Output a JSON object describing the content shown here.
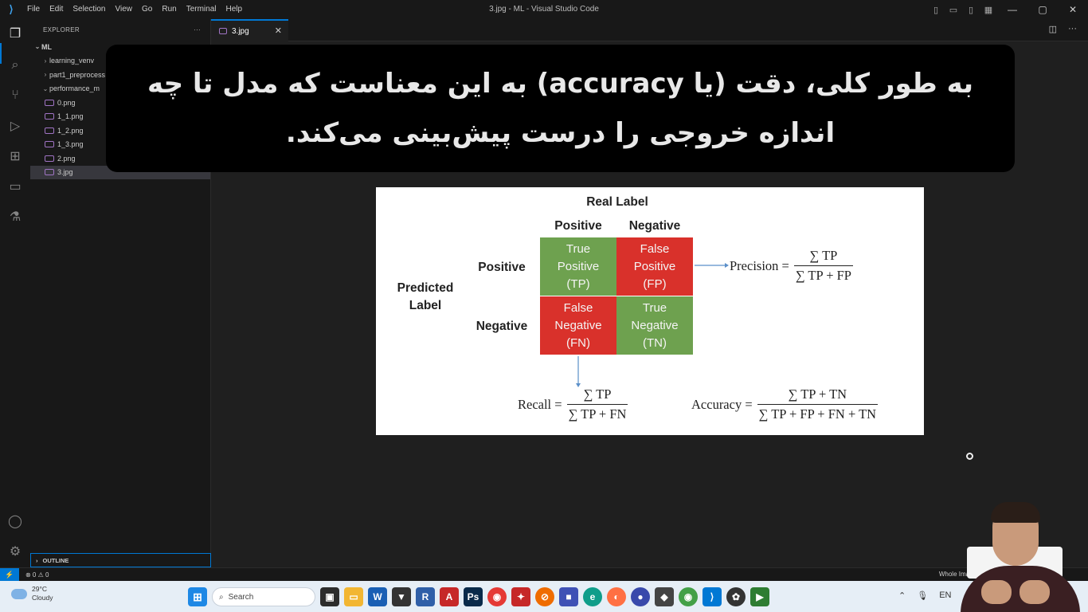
{
  "titlebar": {
    "menu": [
      "File",
      "Edit",
      "Selection",
      "View",
      "Go",
      "Run",
      "Terminal",
      "Help"
    ],
    "window_title": "3.jpg - ML - Visual Studio Code"
  },
  "explorer": {
    "header": "EXPLORER",
    "more": "···",
    "root": "ML",
    "folders": [
      "learning_venv",
      "part1_preprocess",
      "performance_m"
    ],
    "files": [
      "0.png",
      "1_1.png",
      "1_2.png",
      "1_3.png",
      "2.png",
      "3.jpg"
    ],
    "outline": "OUTLINE"
  },
  "editor": {
    "tab_label": "3.jpg",
    "tab_close": "✕"
  },
  "subtitle": {
    "line1": "به طور کلی، دقت (یا accuracy) به این معناست که مدل تا چه",
    "line2": "اندازه خروجی را درست پیش‌بینی می‌کند."
  },
  "figure": {
    "real_label": "Real Label",
    "col_positive": "Positive",
    "col_negative": "Negative",
    "predicted_label_line1": "Predicted",
    "predicted_label_line2": "Label",
    "row_positive": "Positive",
    "row_negative": "Negative",
    "cells": [
      {
        "l1": "True",
        "l2": "Positive",
        "l3": "(TP)"
      },
      {
        "l1": "False",
        "l2": "Positive",
        "l3": "(FP)"
      },
      {
        "l1": "False",
        "l2": "Negative",
        "l3": "(FN)"
      },
      {
        "l1": "True",
        "l2": "Negative",
        "l3": "(TN)"
      }
    ],
    "precision": {
      "label": "Precision =",
      "num": "∑ TP",
      "den": "∑ TP + FP"
    },
    "recall": {
      "label": "Recall =",
      "num": "∑ TP",
      "den": "∑ TP + FN"
    },
    "accuracy": {
      "label": "Accuracy =",
      "num": "∑ TP + TN",
      "den": "∑ TP + FP + FN + TN"
    }
  },
  "statusbar": {
    "problems": "⊗ 0 ⚠ 0",
    "right": "Whole Image"
  },
  "taskbar": {
    "temp": "29°C",
    "condition": "Cloudy",
    "search": "Search",
    "lang": "EN"
  },
  "colors": {
    "accent": "#0078d4",
    "true_cell": "#6ea14f",
    "false_cell": "#d9312b"
  }
}
